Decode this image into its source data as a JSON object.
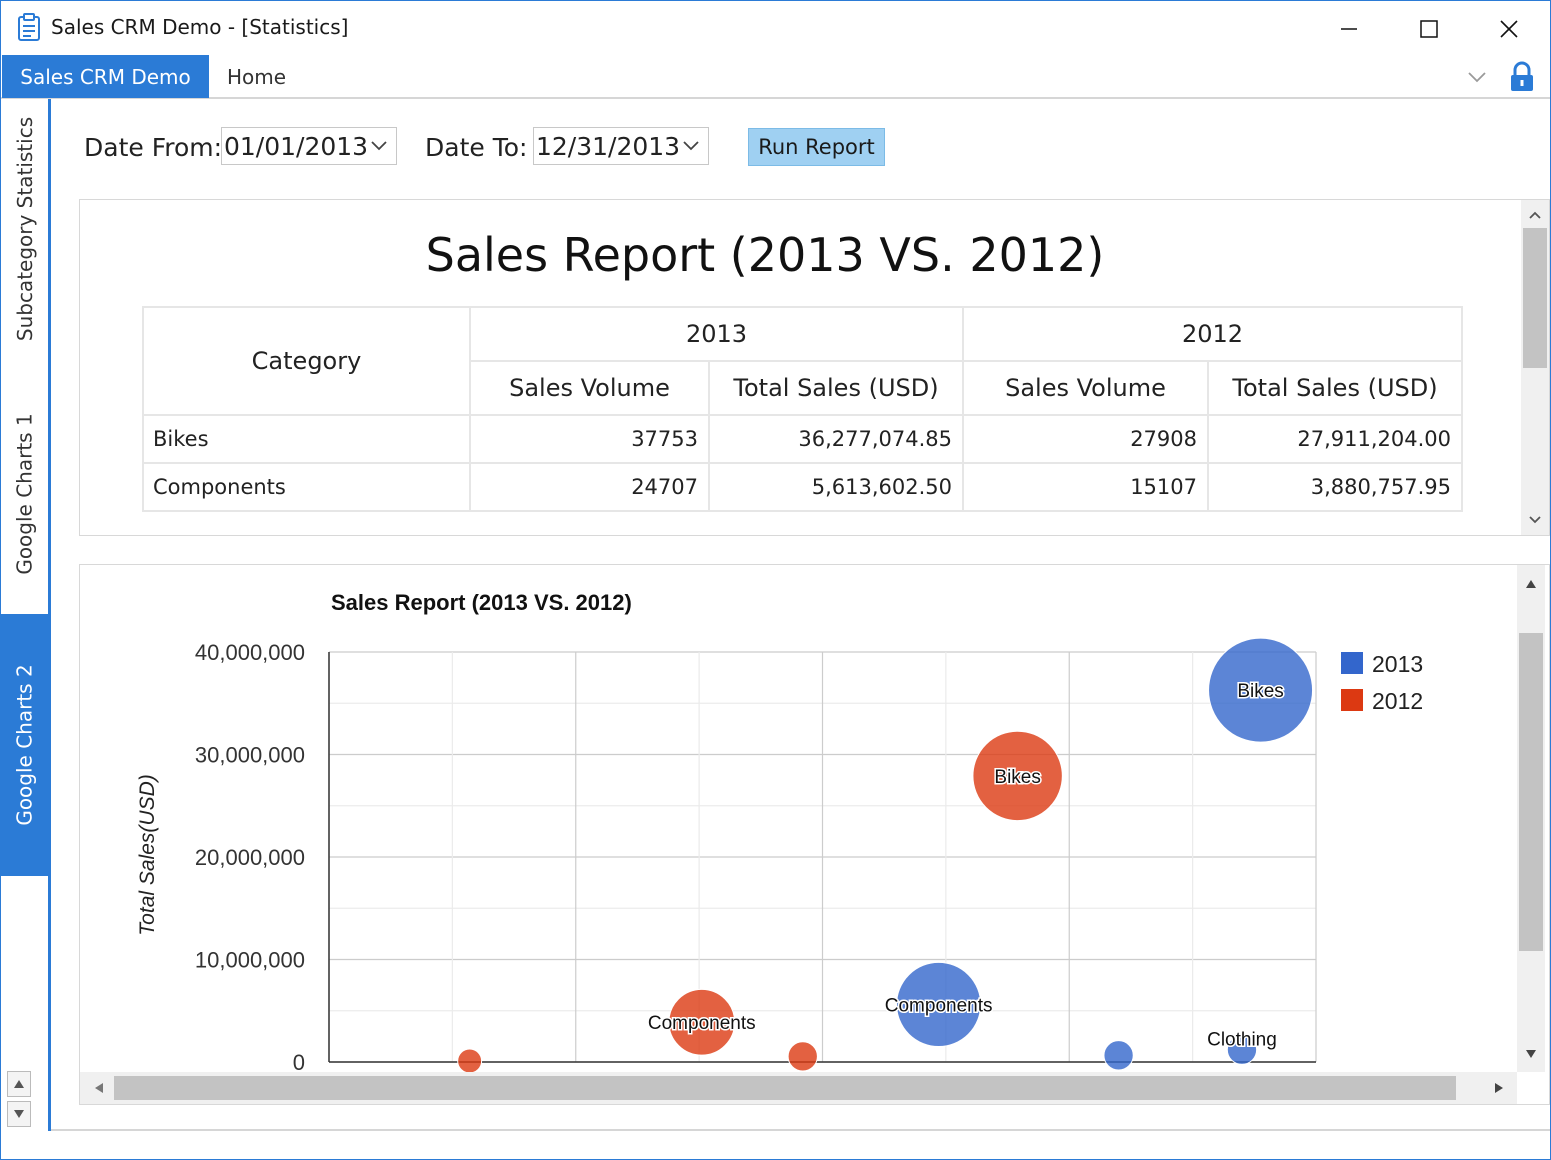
{
  "window": {
    "title": "Sales CRM Demo - [Statistics]",
    "accent_color": "#2b7bd6"
  },
  "ribbon": {
    "app_tab": "Sales CRM Demo",
    "home_tab": "Home"
  },
  "nav": {
    "tabs": [
      {
        "label": "Subcategory Statistics",
        "active": false
      },
      {
        "label": "Google Charts 1",
        "active": false
      },
      {
        "label": "Google Charts 2",
        "active": true
      }
    ]
  },
  "filter": {
    "date_from_label": "Date From:",
    "date_from_value": "01/01/2013",
    "date_to_label": "Date To:",
    "date_to_value": "12/31/2013",
    "run_button": "Run Report"
  },
  "report": {
    "title": "Sales Report (2013 VS. 2012)",
    "header": {
      "category": "Category",
      "year_a": "2013",
      "year_b": "2012",
      "sales_volume": "Sales Volume",
      "total_sales": "Total Sales (USD)"
    },
    "rows": [
      {
        "category": "Bikes",
        "vol_2013": "37753",
        "sales_2013": "36,277,074.85",
        "vol_2012": "27908",
        "sales_2012": "27,911,204.00"
      },
      {
        "category": "Components",
        "vol_2013": "24707",
        "sales_2013": "5,613,602.50",
        "vol_2012": "15107",
        "sales_2012": "3,880,757.95"
      }
    ]
  },
  "chart_data": {
    "type": "scatter",
    "title": "Sales Report (2013 VS. 2012)",
    "ylabel": "Total Sales(USD)",
    "xlabel": "",
    "ylim": [
      0,
      40000000
    ],
    "xlim": [
      0,
      40000
    ],
    "yticks": [
      "0",
      "10,000,000",
      "20,000,000",
      "30,000,000",
      "40,000,000"
    ],
    "grid": true,
    "legend_position": "right",
    "series": [
      {
        "name": "2013",
        "color": "#3366cc",
        "points": [
          {
            "label": "Bikes",
            "x": 37753,
            "y": 36277074.85,
            "size": 37753
          },
          {
            "label": "Components",
            "x": 24707,
            "y": 5613602.5,
            "size": 24707
          },
          {
            "label": "",
            "x": 32000,
            "y": 650000,
            "size": 3000
          },
          {
            "label": "Clothing",
            "x": 37000,
            "y": 1200000,
            "size": 3000
          }
        ]
      },
      {
        "name": "2012",
        "color": "#dc3912",
        "points": [
          {
            "label": "Bikes",
            "x": 27908,
            "y": 27911204.0,
            "size": 27908
          },
          {
            "label": "Components",
            "x": 15107,
            "y": 3880757.95,
            "size": 15107
          },
          {
            "label": "",
            "x": 19200,
            "y": 550000,
            "size": 3000
          },
          {
            "label": "",
            "x": 5700,
            "y": 100000,
            "size": 2000
          }
        ]
      }
    ]
  }
}
